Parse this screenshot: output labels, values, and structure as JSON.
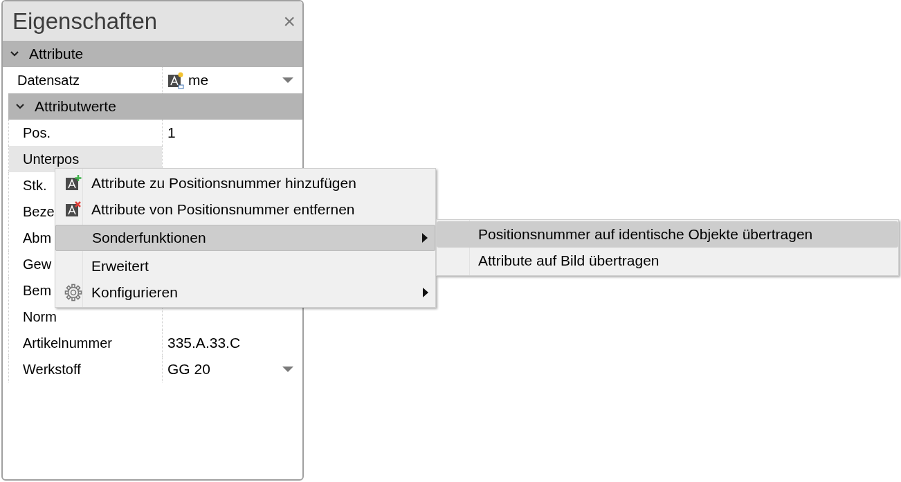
{
  "panel": {
    "title": "Eigenschaften",
    "close": "×",
    "sections": [
      {
        "label": "Attribute",
        "expanded": true,
        "rows": [
          {
            "label": "Datensatz",
            "value": "me",
            "kind": "record",
            "dropdown": true,
            "selected": false
          }
        ],
        "subsections": [
          {
            "label": "Attributwerte",
            "expanded": true,
            "rows": [
              {
                "label": "Pos.",
                "value": "1",
                "kind": "text",
                "dropdown": false,
                "selected": false
              },
              {
                "label": "Unterpos",
                "kind": "text",
                "dropdown": false,
                "selected": true
              },
              {
                "label": "Stk.",
                "kind": "text",
                "selected": false
              },
              {
                "label": "Beze",
                "kind": "text",
                "selected": false
              },
              {
                "label": "Abm",
                "kind": "text",
                "selected": false
              },
              {
                "label": "Gew",
                "kind": "text",
                "selected": false
              },
              {
                "label": "Bem",
                "kind": "text",
                "selected": false
              },
              {
                "label": "Norm",
                "kind": "text",
                "dropdown": false,
                "selected": false
              },
              {
                "label": "Artikelnummer",
                "value": "335.A.33.C",
                "kind": "text",
                "dropdown": false,
                "selected": false
              },
              {
                "label": "Werkstoff",
                "value": "GG 20",
                "kind": "text",
                "dropdown": true,
                "selected": false
              }
            ]
          }
        ]
      }
    ]
  },
  "context_menu": {
    "items": [
      {
        "label": "Attribute zu Positionsnummer hinzufügen",
        "kind": "add",
        "has_submenu": false,
        "selected": false
      },
      {
        "label": "Attribute von Positionsnummer entfernen",
        "kind": "remove",
        "has_submenu": false,
        "selected": false
      },
      {
        "label": "Sonderfunktionen",
        "kind": "plain",
        "has_submenu": true,
        "selected": true
      },
      {
        "label": "Erweitert",
        "kind": "plain",
        "has_submenu": false,
        "selected": false
      },
      {
        "label": "Konfigurieren",
        "kind": "gear",
        "has_submenu": true,
        "selected": false
      }
    ]
  },
  "submenu": {
    "items": [
      {
        "label": "Positionsnummer auf identische Objekte übertragen",
        "selected": true
      },
      {
        "label": "Attribute auf Bild übertragen",
        "selected": false
      }
    ]
  }
}
